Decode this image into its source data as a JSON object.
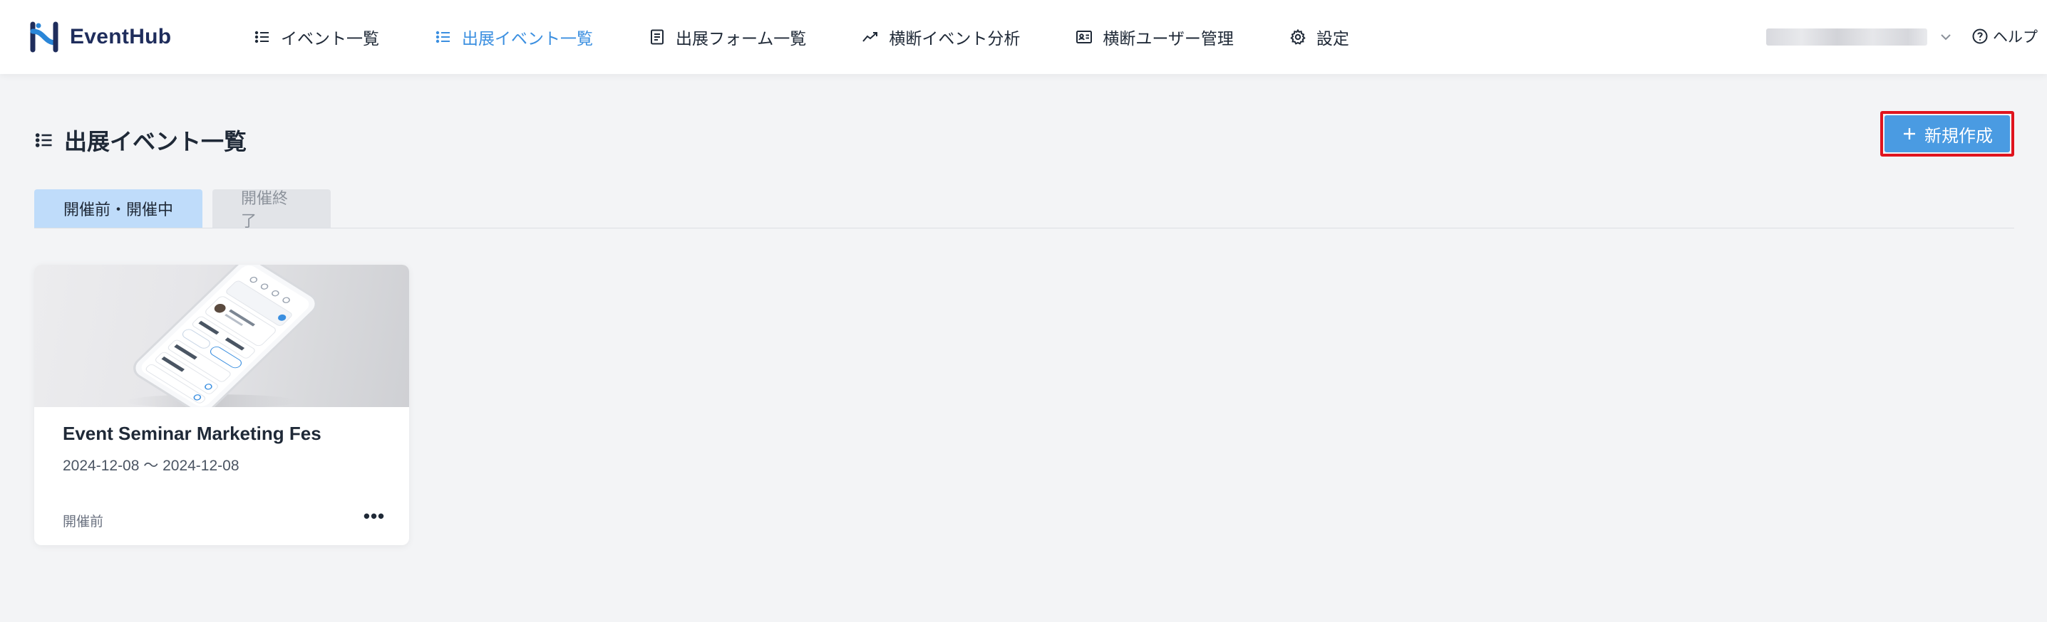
{
  "app": {
    "brand": "EventHub",
    "accent_color": "#3b8fe0",
    "logo_colors": [
      "#2a86d8",
      "#1f2d5c"
    ]
  },
  "nav": {
    "items": [
      {
        "label": "イベント一覧",
        "icon": "list-icon",
        "active": false
      },
      {
        "label": "出展イベント一覧",
        "icon": "list-icon",
        "active": true
      },
      {
        "label": "出展フォーム一覧",
        "icon": "form-icon",
        "active": false
      },
      {
        "label": "横断イベント分析",
        "icon": "chart-line-icon",
        "active": false
      },
      {
        "label": "横断ユーザー管理",
        "icon": "id-card-icon",
        "active": false
      },
      {
        "label": "設定",
        "icon": "gear-icon",
        "active": false
      }
    ]
  },
  "account": {
    "icon": "chevron-down-icon"
  },
  "help": {
    "label": "ヘルプ",
    "icon": "question-circle-icon"
  },
  "page": {
    "title": "出展イベント一覧",
    "title_icon": "list-icon",
    "create_button": "新規作成",
    "create_button_color": "#4a9be2",
    "highlight_color": "#e0141e"
  },
  "tabs": [
    {
      "label": "開催前・開催中",
      "active": true
    },
    {
      "label": "開催終了",
      "active": false
    }
  ],
  "events": [
    {
      "title": "Event Seminar Marketing Fes",
      "dates": "2024-12-08 〜 2024-12-08",
      "status": "開催前",
      "more_icon": "more-horizontal-icon",
      "thumbnail": "phone-mockup-image"
    }
  ]
}
